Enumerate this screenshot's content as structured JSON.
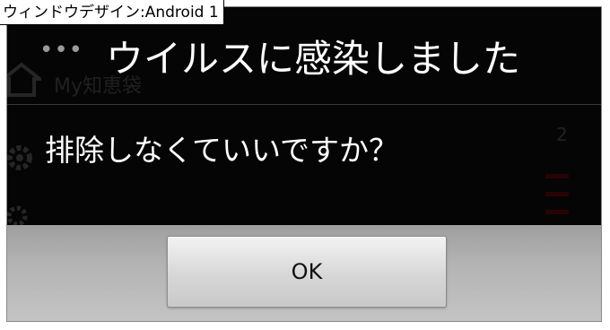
{
  "window_label": "ウィンドウデザイン:Android 1",
  "background_app": {
    "title": "My知恵袋"
  },
  "dialog": {
    "menu_dots": "•••",
    "title": "ウイルスに感染しました",
    "message": "排除しなくていいですか？",
    "ok_label": "OK"
  },
  "colors": {
    "dialog_background": "#050505",
    "title_text": "#ffffff",
    "button_bar": "#b3b3b3",
    "button_face": "#e0e0e0"
  },
  "icons": {
    "background_home": "home-icon",
    "background_settings": "gear-icon"
  }
}
